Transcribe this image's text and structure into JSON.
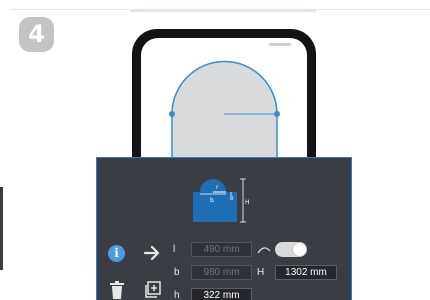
{
  "step": {
    "number": "4"
  },
  "shape_diagram": {
    "radius_label": "r",
    "width_label": "b",
    "height_label": "H",
    "side_label": "h",
    "inner_label": "l"
  },
  "fields": {
    "l": {
      "label": "l",
      "value": "490 mm"
    },
    "b": {
      "label": "b",
      "value": "980 mm"
    },
    "H": {
      "label": "H",
      "value": "1302 mm"
    },
    "h": {
      "label": "h",
      "value": "322 mm"
    }
  },
  "toggle": {
    "on": true
  },
  "colors": {
    "panel": "#3a3d44",
    "accent": "#2f7fc1",
    "shape_fill": "#d9dadc",
    "diagram_fill": "#1f6fb5"
  },
  "icons": {
    "info": "info-icon",
    "arrow": "arrow-right-icon",
    "trash": "trash-icon",
    "add": "add-box-icon",
    "curve": "curve-icon"
  }
}
